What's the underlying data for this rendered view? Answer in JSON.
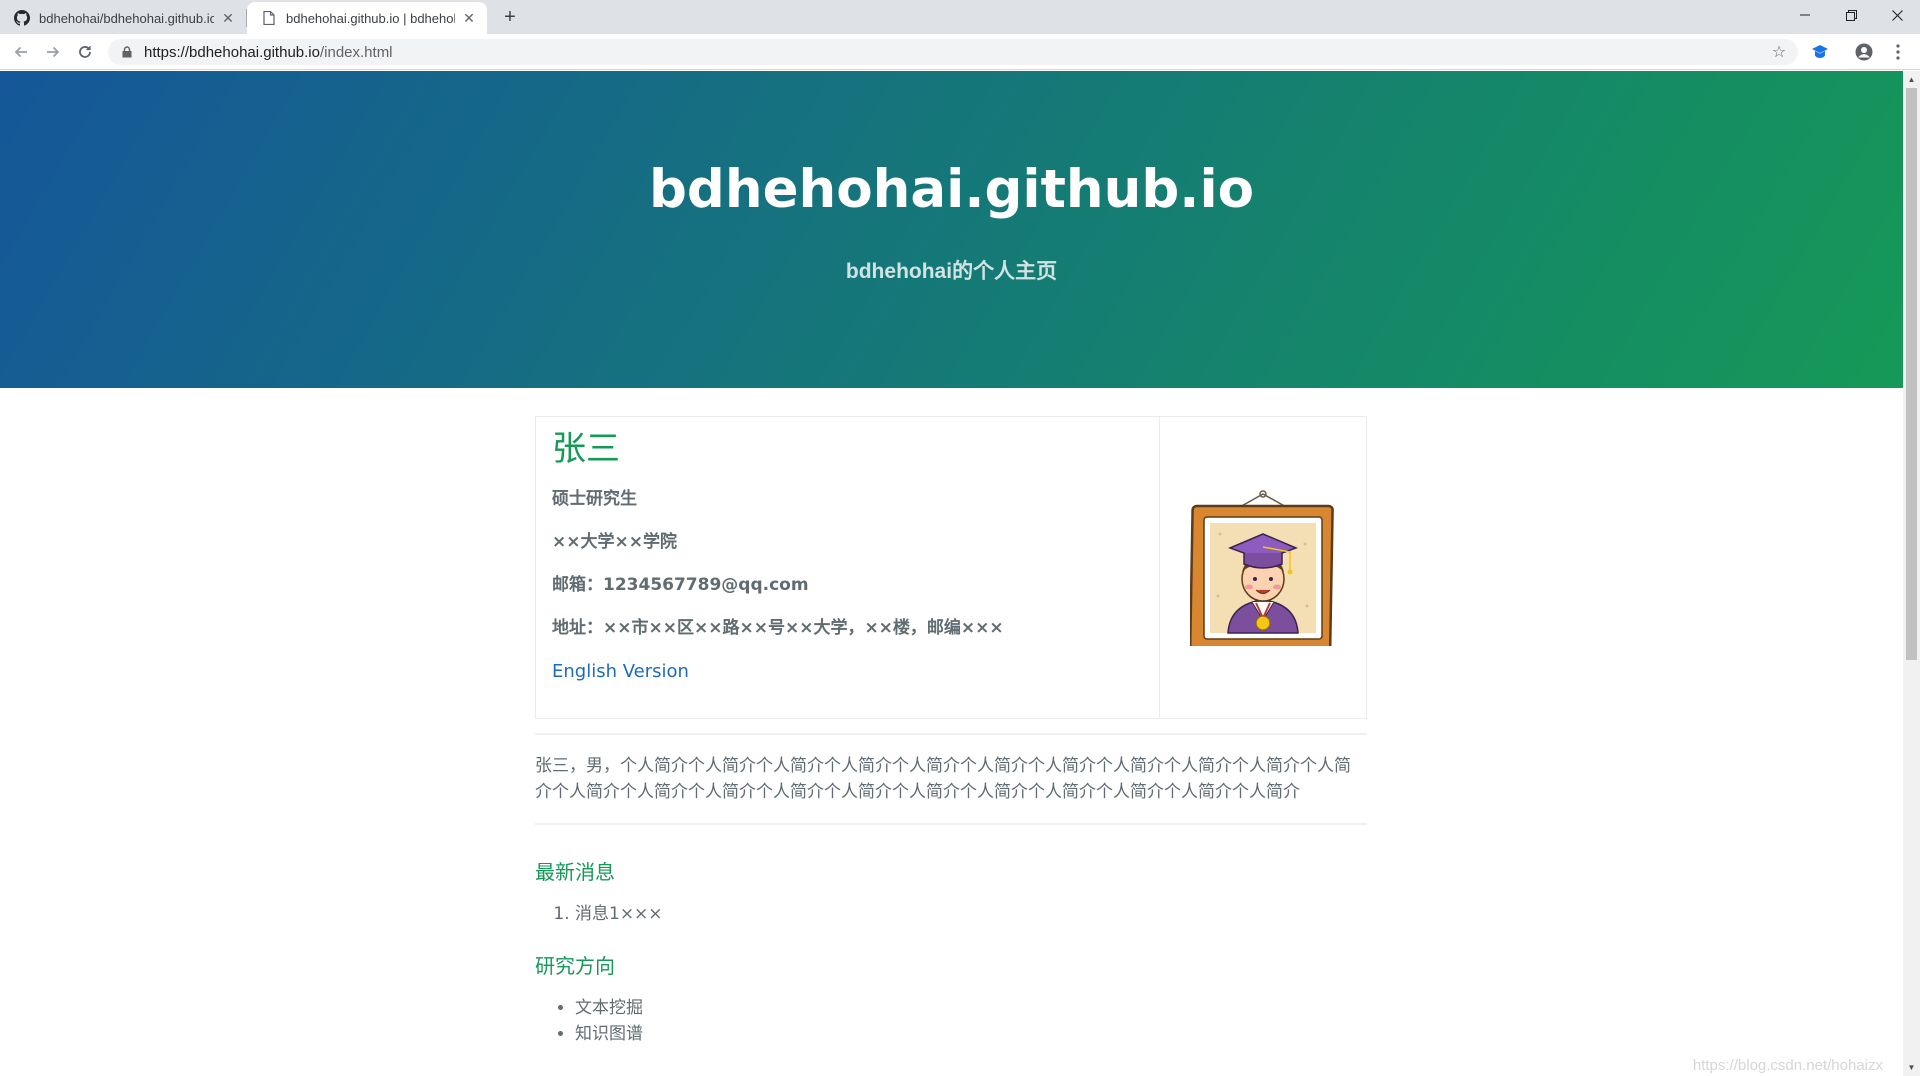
{
  "browser": {
    "tabs": [
      {
        "title": "bdhehohai/bdhehohai.github.io",
        "icon": "github-icon",
        "active": false
      },
      {
        "title": "bdhehohai.github.io | bdhehohai",
        "icon": "page-icon",
        "active": true
      }
    ],
    "url_host": "https://bdhehohai.github.io",
    "url_path": "/index.html"
  },
  "hero": {
    "title": "bdhehohai.github.io",
    "subtitle": "bdhehohai的个人主页"
  },
  "profile": {
    "name": "张三",
    "degree": "硕士研究生",
    "school": "××大学××学院",
    "email": "邮箱：1234567789@qq.com",
    "address": "地址：××市××区××路××号××大学，××楼，邮编×××",
    "english_link": "English Version"
  },
  "bio": "张三，男，个人简介个人简介个人简介个人简介个人简介个人简介个人简介个人简介个人简介个人简介个人简介个人简介个人简介个人简介个人简介个人简介个人简介个人简介个人简介个人简介个人简介个人简介",
  "news": {
    "title": "最新消息",
    "items": [
      "消息1×××"
    ]
  },
  "research": {
    "title": "研究方向",
    "items": [
      "文本挖掘",
      "知识图谱"
    ]
  },
  "watermark": "https://blog.csdn.net/hohaizx",
  "colors": {
    "hero_start": "#155799",
    "hero_end": "#159957",
    "heading": "#159957",
    "link": "#1e6bb8",
    "text": "#606c71"
  }
}
